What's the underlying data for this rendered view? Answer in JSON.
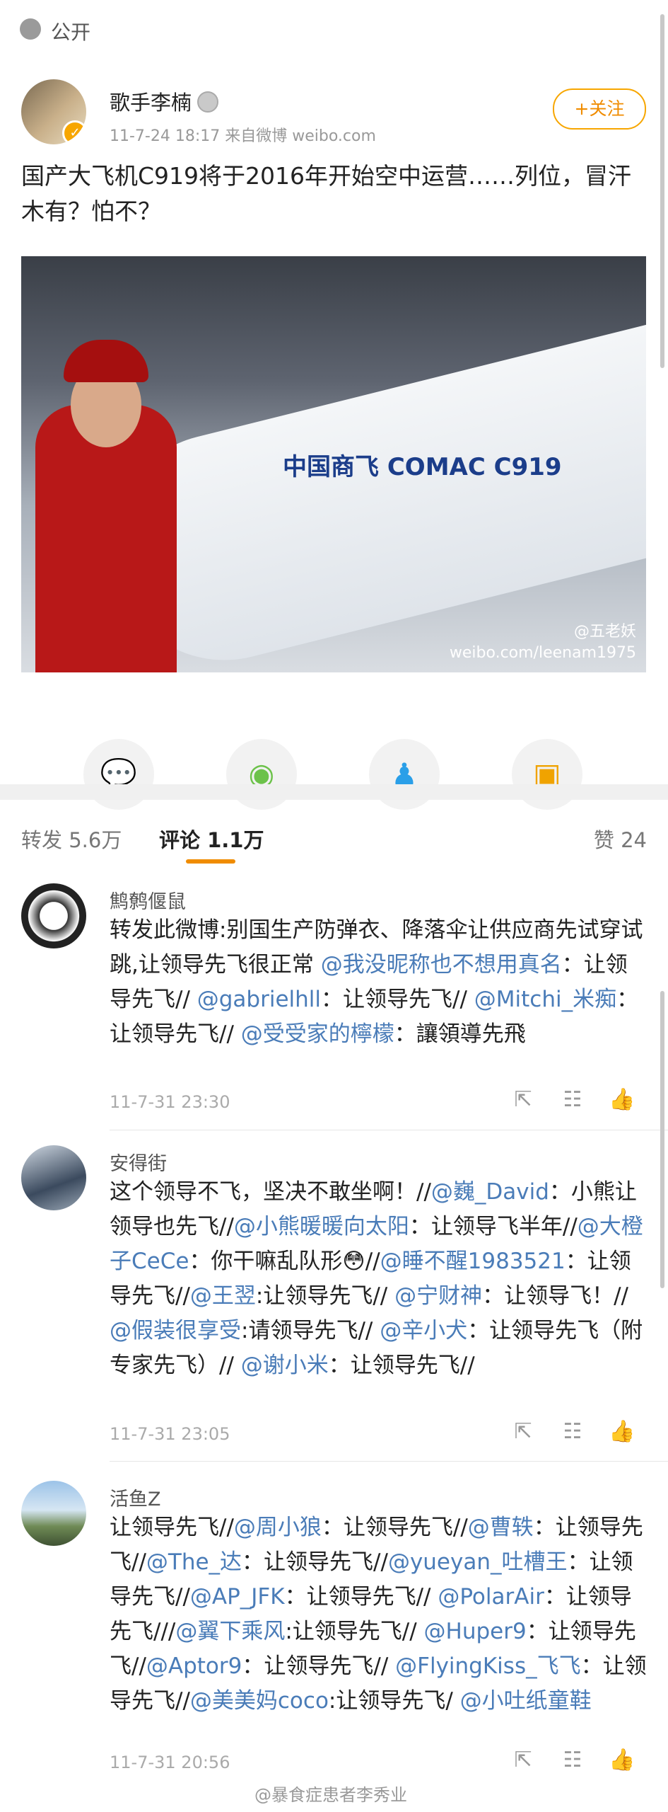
{
  "topbar": {
    "visibility": "公开"
  },
  "post": {
    "author": "歌手李楠",
    "meta": "11-7-24 18:17  来自微博 weibo.com",
    "follow_label": "+关注",
    "text": "国产大飞机C919将于2016年开始空中运营……列位，冒汗木有？怕不？",
    "photo_logo": "中国商飞 COMAC C919",
    "photo_watermark_1": "@五老妖",
    "photo_watermark_2": "weibo.com/leenam1975"
  },
  "share_icons": [
    "wechat-icon",
    "moments-icon",
    "qq-icon",
    "save-image-icon"
  ],
  "tabs": {
    "repost": "转发 5.6万",
    "comment": "评论 1.1万",
    "like": "赞 24"
  },
  "comments": [
    {
      "name": "鹪鹩偃鼠",
      "time": "11-7-31 23:30",
      "parts": [
        [
          "t",
          "转发此微博:别国生产防弹衣、降落伞让供应商先试穿试跳,让领导先飞很正常 "
        ],
        [
          "m",
          "@我没昵称也不想用真名"
        ],
        [
          "t",
          "：让领导先飞// "
        ],
        [
          "m",
          "@gabrielhll"
        ],
        [
          "t",
          "：让领导先飞// "
        ],
        [
          "m",
          "@Mitchi_米痴"
        ],
        [
          "t",
          "：让领导先飞// "
        ],
        [
          "m",
          "@受受家的檸檬"
        ],
        [
          "t",
          "：讓領導先飛"
        ]
      ]
    },
    {
      "name": "安得街",
      "time": "11-7-31 23:05",
      "parts": [
        [
          "t",
          "这个领导不飞，坚决不敢坐啊！//"
        ],
        [
          "m",
          "@巍_David"
        ],
        [
          "t",
          "：小熊让领导也先飞//"
        ],
        [
          "m",
          "@小熊暖暖向太阳"
        ],
        [
          "t",
          "：让领导飞半年//"
        ],
        [
          "m",
          "@大橙子CeCe"
        ],
        [
          "t",
          "：你干嘛乱队形😳//"
        ],
        [
          "m",
          "@睡不醒1983521"
        ],
        [
          "t",
          "：让领导先飞//"
        ],
        [
          "m",
          "@王翌"
        ],
        [
          "t",
          ":让领导先飞// "
        ],
        [
          "m",
          "@宁财神"
        ],
        [
          "t",
          "：让领导飞！// "
        ],
        [
          "m",
          "@假装很享受"
        ],
        [
          "t",
          ":请领导先飞// "
        ],
        [
          "m",
          "@辛小犬"
        ],
        [
          "t",
          "：让领导先飞（附专家先飞）// "
        ],
        [
          "m",
          "@谢小米"
        ],
        [
          "t",
          "：让领导先飞//"
        ]
      ]
    },
    {
      "name": "活鱼Z",
      "time": "11-7-31 20:56",
      "parts": [
        [
          "t",
          "让领导先飞//"
        ],
        [
          "m",
          "@周小狼"
        ],
        [
          "t",
          "：让领导先飞//"
        ],
        [
          "m",
          "@曹轶"
        ],
        [
          "t",
          "：让领导先飞//"
        ],
        [
          "m",
          "@The_达"
        ],
        [
          "t",
          "：让领导先飞//"
        ],
        [
          "m",
          "@yueyan_吐槽王"
        ],
        [
          "t",
          "：让领导先飞//"
        ],
        [
          "m",
          "@AP_JFK"
        ],
        [
          "t",
          "：让领导先飞// "
        ],
        [
          "m",
          "@PolarAir"
        ],
        [
          "t",
          "：让领导先飞///"
        ],
        [
          "m",
          "@翼下乘风"
        ],
        [
          "t",
          ":让领导先飞// "
        ],
        [
          "m",
          "@Huper9"
        ],
        [
          "t",
          "：让领导先飞//"
        ],
        [
          "m",
          "@Aptor9"
        ],
        [
          "t",
          "：让领导先飞// "
        ],
        [
          "m",
          "@FlyingKiss_飞飞"
        ],
        [
          "t",
          "：让领导先飞//"
        ],
        [
          "m",
          "@美美妈coco"
        ],
        [
          "t",
          ":让领导先飞/ "
        ],
        [
          "m",
          "@小吐纸童鞋"
        ]
      ]
    }
  ],
  "footer_watermark": "@暴食症患者李秀业"
}
